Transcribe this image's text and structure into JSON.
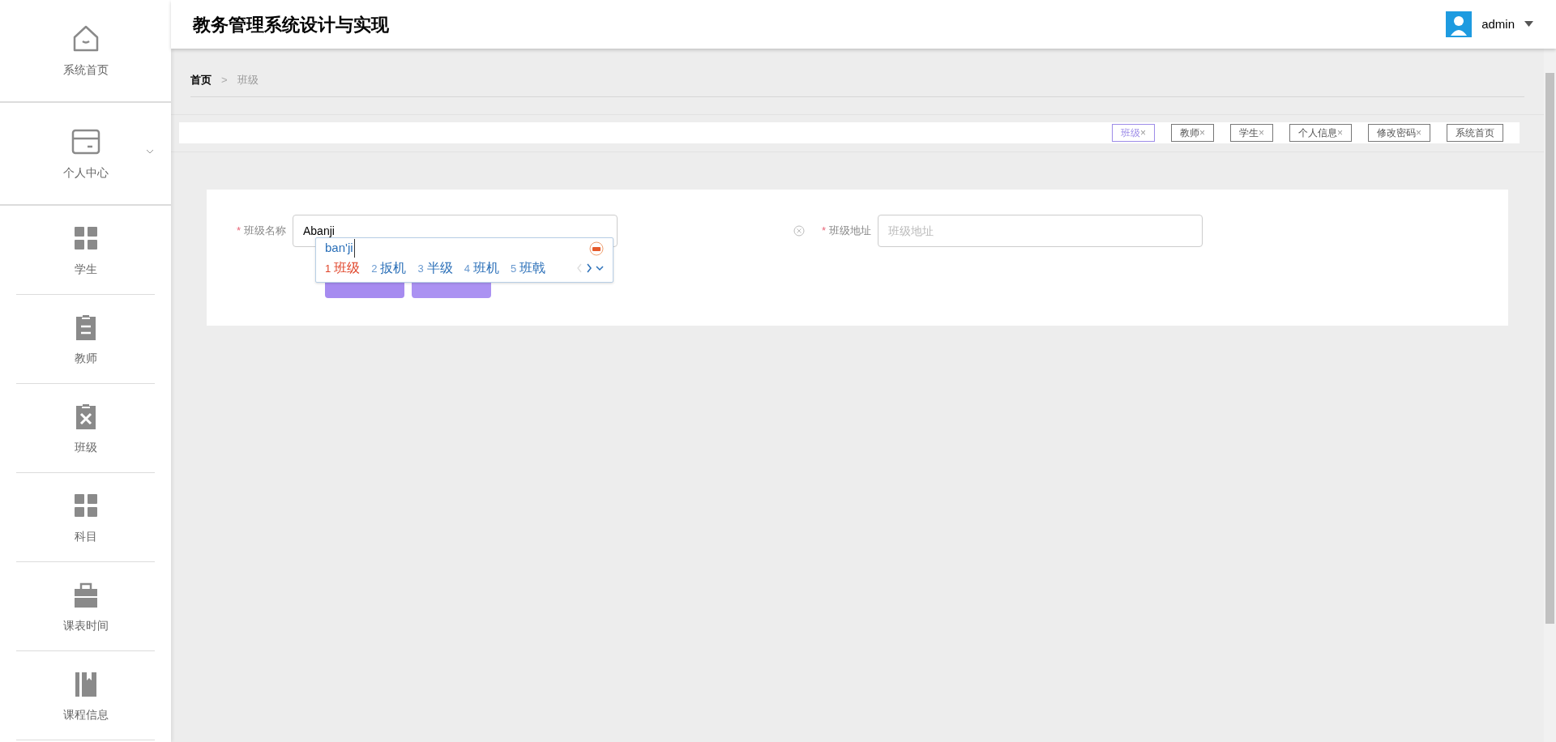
{
  "sidebar": {
    "items": [
      {
        "label": "系统首页",
        "kind": "link"
      },
      {
        "label": "个人中心",
        "kind": "submenu",
        "expanded": false
      },
      {
        "label": "学生",
        "kind": "link"
      },
      {
        "label": "教师",
        "kind": "link"
      },
      {
        "label": "班级",
        "kind": "link"
      },
      {
        "label": "科目",
        "kind": "link"
      },
      {
        "label": "课表时间",
        "kind": "link"
      },
      {
        "label": "课程信息",
        "kind": "link"
      }
    ]
  },
  "header": {
    "title": "教务管理系统设计与实现",
    "user": "admin"
  },
  "breadcrumb": [
    {
      "label": "首页",
      "current": false
    },
    {
      "separator": ">",
      "label": "班级",
      "current": true
    }
  ],
  "tabs": [
    {
      "label": "班级",
      "close": "×",
      "selected": true
    },
    {
      "label": "教师",
      "close": "×",
      "selected": false
    },
    {
      "label": "学生",
      "close": "×",
      "selected": false
    },
    {
      "label": "个人信息",
      "close": "×",
      "selected": false
    },
    {
      "label": "修改密码",
      "close": "×",
      "selected": false
    },
    {
      "label": "系统首页",
      "selected": false
    }
  ],
  "form": {
    "fields": [
      {
        "label": "班级名称",
        "required": "*",
        "value": "Abanji",
        "clearable": false
      },
      {
        "label": "班级地址",
        "required": "*",
        "placeholder": "班级地址",
        "clearable": true
      }
    ],
    "buttons": [
      {
        "kind": "submit"
      },
      {
        "kind": "cancel"
      }
    ]
  },
  "ime": {
    "composition": "ban'ji",
    "candidates": [
      {
        "number": "1",
        "word": "班级",
        "selected": true
      },
      {
        "number": "2",
        "word": "扳机",
        "selected": false
      },
      {
        "number": "3",
        "word": "半级",
        "selected": false
      },
      {
        "number": "4",
        "word": "班机",
        "selected": false
      },
      {
        "number": "5",
        "word": "班戟",
        "selected": false
      }
    ]
  }
}
